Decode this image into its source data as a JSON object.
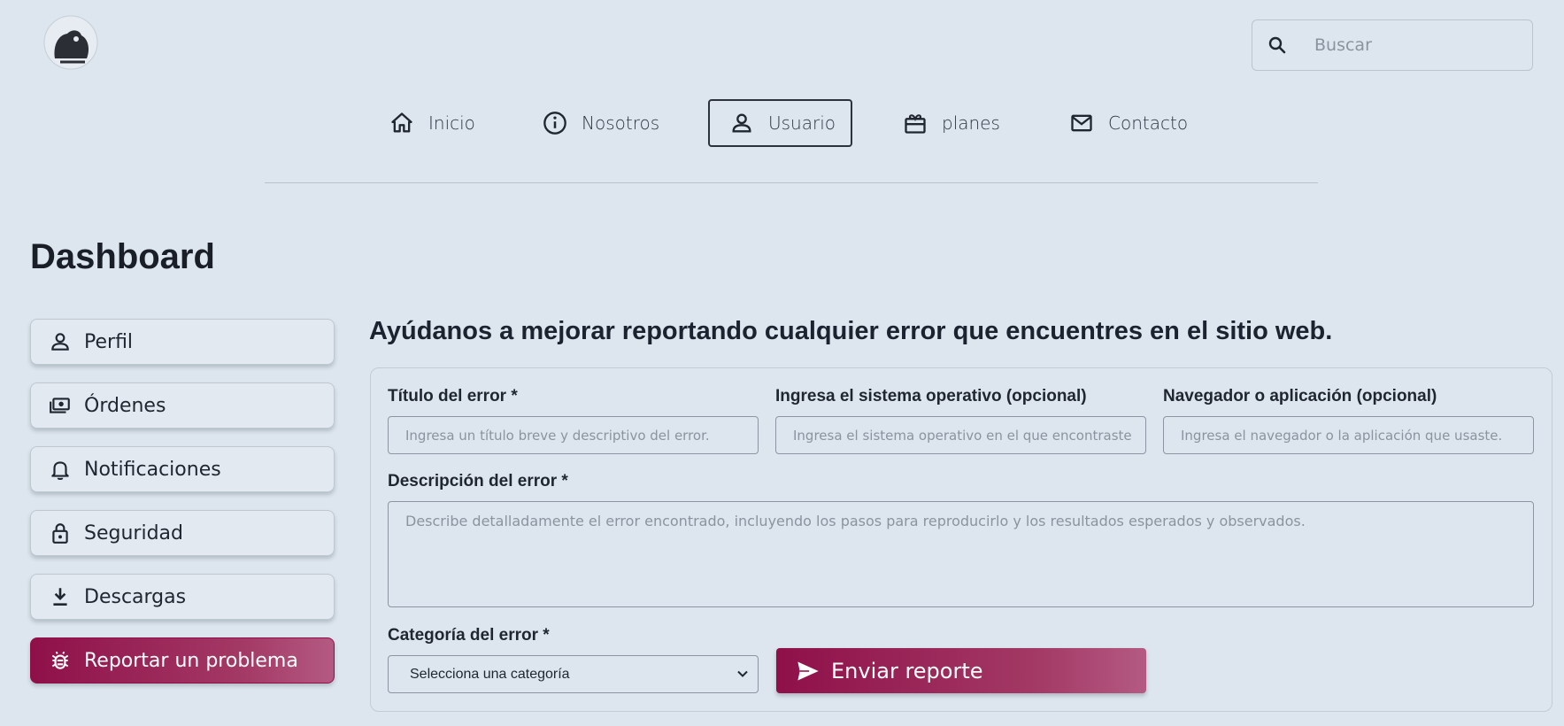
{
  "search": {
    "placeholder": "Buscar"
  },
  "nav": {
    "items": [
      {
        "label": "Inicio",
        "icon": "home-icon"
      },
      {
        "label": "Nosotros",
        "icon": "info-icon"
      },
      {
        "label": "Usuario",
        "icon": "user-icon"
      },
      {
        "label": "planes",
        "icon": "gift-icon"
      },
      {
        "label": "Contacto",
        "icon": "mail-icon"
      }
    ]
  },
  "page": {
    "title": "Dashboard"
  },
  "sidebar": {
    "items": [
      {
        "label": "Perfil",
        "icon": "user-icon"
      },
      {
        "label": "Órdenes",
        "icon": "orders-icon"
      },
      {
        "label": "Notificaciones",
        "icon": "bell-icon"
      },
      {
        "label": "Seguridad",
        "icon": "lock-icon"
      },
      {
        "label": "Descargas",
        "icon": "download-icon"
      },
      {
        "label": "Reportar un problema",
        "icon": "bug-icon"
      }
    ]
  },
  "report": {
    "heading": "Ayúdanos a mejorar reportando cualquier error que encuentres en el sitio web.",
    "title_label": "Título del error *",
    "title_placeholder": "Ingresa un título breve y descriptivo del error.",
    "os_label": "Ingresa el sistema operativo (opcional)",
    "os_placeholder": "Ingresa el sistema operativo en el que encontraste",
    "browser_label": "Navegador o aplicación (opcional)",
    "browser_placeholder": "Ingresa el navegador o la aplicación que usaste.",
    "description_label": "Descripción del error *",
    "description_placeholder": "Describe detalladamente el error encontrado, incluyendo los pasos para reproducirlo y los resultados esperados y observados.",
    "category_label": "Categoría del error *",
    "category_value": "Selecciona una categoría",
    "submit_label": "Enviar reporte"
  },
  "colors": {
    "accent": "#8f1049",
    "background": "#dde6ee"
  }
}
